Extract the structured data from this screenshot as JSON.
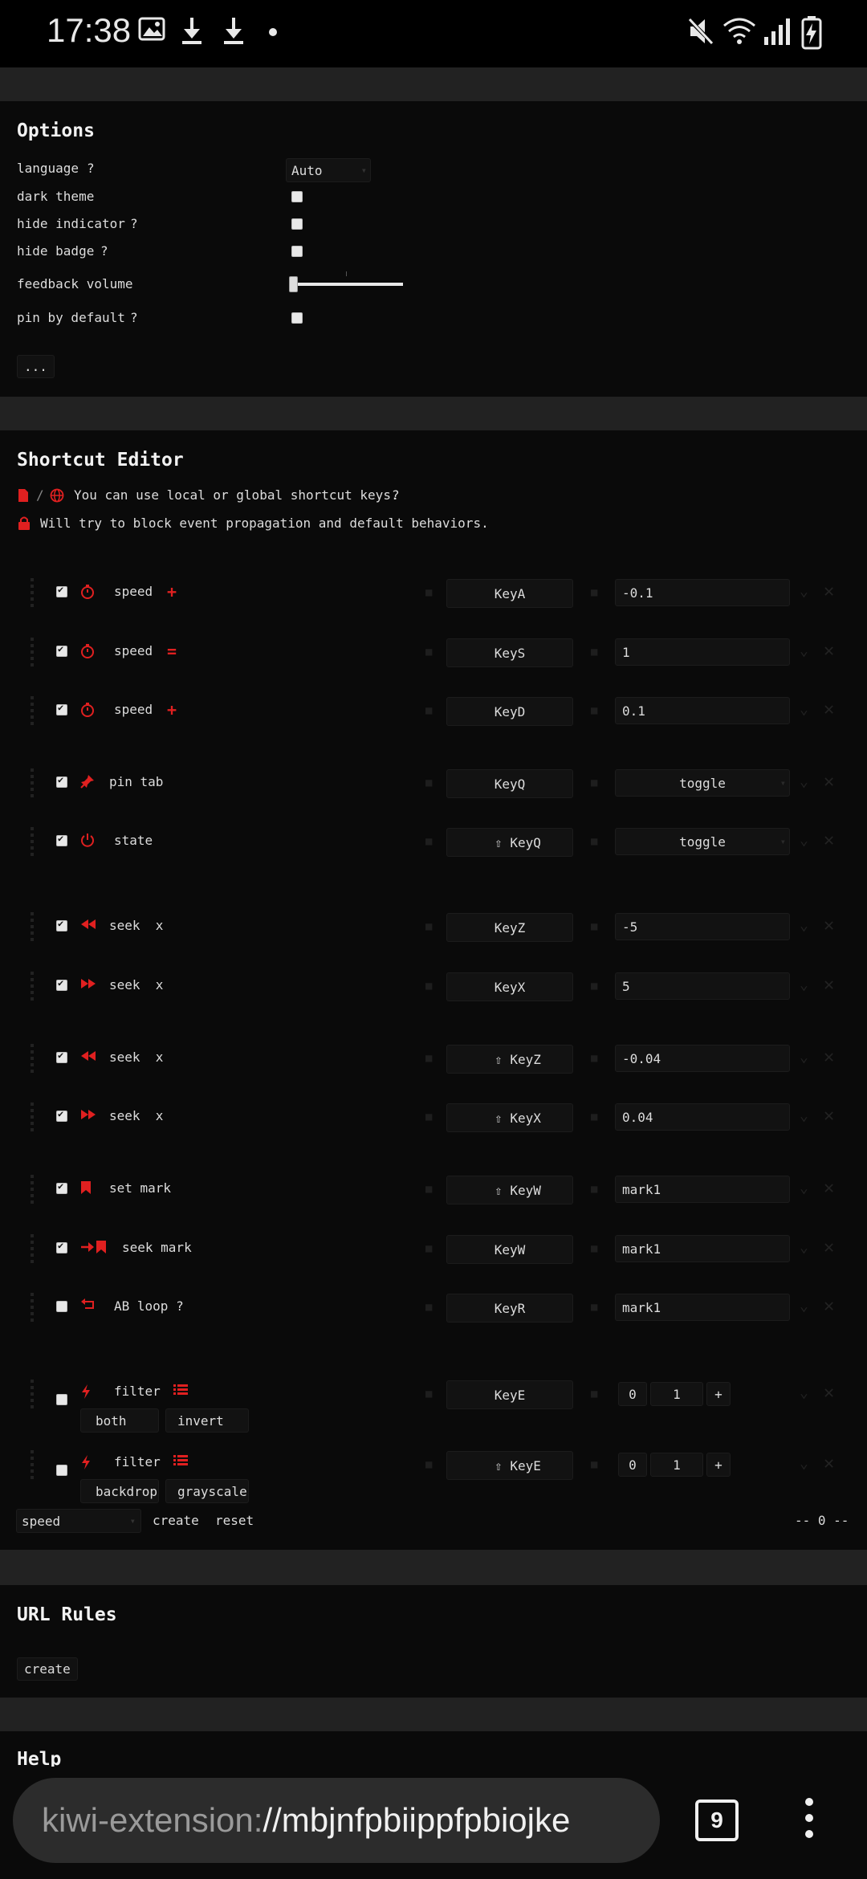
{
  "status_bar": {
    "time": "17:38",
    "icons_left": [
      "image-icon",
      "download-icon",
      "download-icon",
      "dot-icon"
    ],
    "icons_right": [
      "mute-icon",
      "wifi-icon",
      "signal-icon",
      "battery-charging-icon"
    ]
  },
  "options": {
    "title": "Options",
    "language_label": "language",
    "language_help": "?",
    "language_value": "Auto",
    "dark_theme_label": "dark theme",
    "hide_indicator_label": "hide indicator",
    "hide_indicator_help": "?",
    "hide_badge_label": "hide badge",
    "hide_badge_help": "?",
    "feedback_volume_label": "feedback volume",
    "feedback_volume_value": 0,
    "pin_by_default_label": "pin by default",
    "pin_by_default_help": "?",
    "more_label": "..."
  },
  "shortcut_editor": {
    "title": "Shortcut Editor",
    "info_local_global": "You can use local or global shortcut keys.",
    "info_help": "?",
    "info_block": "Will try to block event propagation and default behaviors.",
    "rows": [
      {
        "enabled": true,
        "icon": "stopwatch-icon",
        "label": "speed",
        "suffix_icon": "plus-icon",
        "suffix": "+",
        "key": "KeyA",
        "value": "-0.1"
      },
      {
        "enabled": true,
        "icon": "stopwatch-icon",
        "label": "speed",
        "suffix_icon": "equals-icon",
        "suffix": "=",
        "key": "KeyS",
        "value": "1"
      },
      {
        "enabled": true,
        "icon": "stopwatch-icon",
        "label": "speed",
        "suffix_icon": "plus-icon",
        "suffix": "+",
        "key": "KeyD",
        "value": "0.1"
      },
      {
        "enabled": true,
        "icon": "pin-icon",
        "label": "pin tab",
        "key": "KeyQ",
        "value": "toggle"
      },
      {
        "enabled": true,
        "icon": "power-icon",
        "label": "state",
        "key": "⇧ KeyQ",
        "value": "toggle"
      },
      {
        "enabled": true,
        "icon": "rewind-icon",
        "label": "seek  x",
        "key": "KeyZ",
        "value": "-5"
      },
      {
        "enabled": true,
        "icon": "fast-forward-icon",
        "label": "seek  x",
        "key": "KeyX",
        "value": "5"
      },
      {
        "enabled": true,
        "icon": "rewind-icon",
        "label": "seek  x",
        "key": "⇧ KeyZ",
        "value": "-0.04"
      },
      {
        "enabled": true,
        "icon": "fast-forward-icon",
        "label": "seek  x",
        "key": "⇧ KeyX",
        "value": "0.04"
      },
      {
        "enabled": true,
        "icon": "bookmark-icon",
        "label": "set mark",
        "key": "⇧ KeyW",
        "value": "mark1"
      },
      {
        "enabled": true,
        "icon": "arrow-bookmark-icon",
        "label": "seek mark",
        "key": "KeyW",
        "value": "mark1"
      },
      {
        "enabled": false,
        "icon": "loop-icon",
        "label": "AB loop ?",
        "key": "KeyR",
        "value": "mark1"
      },
      {
        "enabled": false,
        "icon": "bolt-icon",
        "label": "filter",
        "sub1": "both",
        "sub2": "invert",
        "key": "KeyE",
        "v1": "0",
        "v2": "1",
        "plus": "+"
      },
      {
        "enabled": false,
        "icon": "bolt-icon",
        "label": "filter",
        "sub1": "backdrop",
        "sub2": "grayscale",
        "key": "⇧ KeyE",
        "v1": "0",
        "v2": "1",
        "plus": "+"
      }
    ],
    "footer": {
      "select_value": "speed",
      "create_label": "create",
      "reset_label": "reset",
      "pager": "-- 0 --"
    }
  },
  "url_rules": {
    "title": "URL Rules",
    "create_label": "create"
  },
  "help": {
    "title": "Help"
  },
  "browser": {
    "url_scheme": "kiwi-extension:",
    "url_rest": "//mbjnfpbiippfpbiojke",
    "tab_count": "9"
  },
  "colors": {
    "accent": "#e02020",
    "background": "#0a0a0a",
    "separator": "#222222"
  }
}
